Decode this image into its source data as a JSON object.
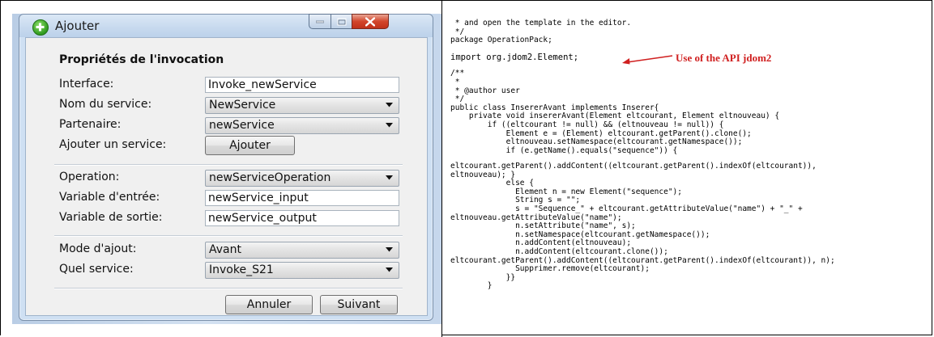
{
  "window": {
    "title": "Ajouter",
    "section_title": "Propriétés de l'invocation"
  },
  "form": {
    "interface_label": "Interface:",
    "interface_value": "Invoke_newService",
    "service_label": "Nom du service:",
    "service_value": "NewService",
    "partner_label": "Partenaire:",
    "partner_value": "newService",
    "add_service_label": "Ajouter un service:",
    "add_service_button": "Ajouter",
    "operation_label": "Operation:",
    "operation_value": "newServiceOperation",
    "input_var_label": "Variable d'entrée:",
    "input_var_value": "newService_input",
    "output_var_label": "Variable de sortie:",
    "output_var_value": "newService_output",
    "add_mode_label": "Mode d'ajout:",
    "add_mode_value": "Avant",
    "which_service_label": "Quel service:",
    "which_service_value": "Invoke_S21"
  },
  "footer": {
    "cancel_label": "Annuler",
    "next_label": "Suivant"
  },
  "annotation": {
    "text": "Use of the API jdom2"
  },
  "code": {
    "lines": [
      " * and open the template in the editor.",
      " */",
      "package OperationPack;",
      "",
      "import org.jdom2.Element;",
      "",
      "/**",
      " *",
      " * @author user",
      " */",
      "public class InsererAvant implements Inserer{",
      "    private void insererAvant(Element eltcourant, Element eltnouveau) {",
      "        if ((eltcourant != null) && (eltnouveau != null)) {",
      "            Element e = (Element) eltcourant.getParent().clone();",
      "            eltnouveau.setNamespace(eltcourant.getNamespace());",
      "            if (e.getName().equals(\"sequence\")) {",
      "",
      "eltcourant.getParent().addContent((eltcourant.getParent().indexOf(eltcourant)),",
      "eltnouveau); }",
      "            else {",
      "              Element n = new Element(\"sequence\");",
      "              String s = \"\";",
      "              s = \"Sequence_\" + eltcourant.getAttributeValue(\"name\") + \"_\" +",
      "eltnouveau.getAttributeValue(\"name\");",
      "              n.setAttribute(\"name\", s);",
      "              n.setNamespace(eltcourant.getNamespace());",
      "              n.addContent(eltnouveau);",
      "              n.addContent(eltcourant.clone());",
      "eltcourant.getParent().addContent((eltcourant.getParent().indexOf(eltcourant)), n);",
      "              Supprimer.remove(eltcourant);",
      "            }}",
      "        }"
    ]
  },
  "colors": {
    "annotation": "#d02020",
    "dialog_frame": "#cfe0f3"
  }
}
